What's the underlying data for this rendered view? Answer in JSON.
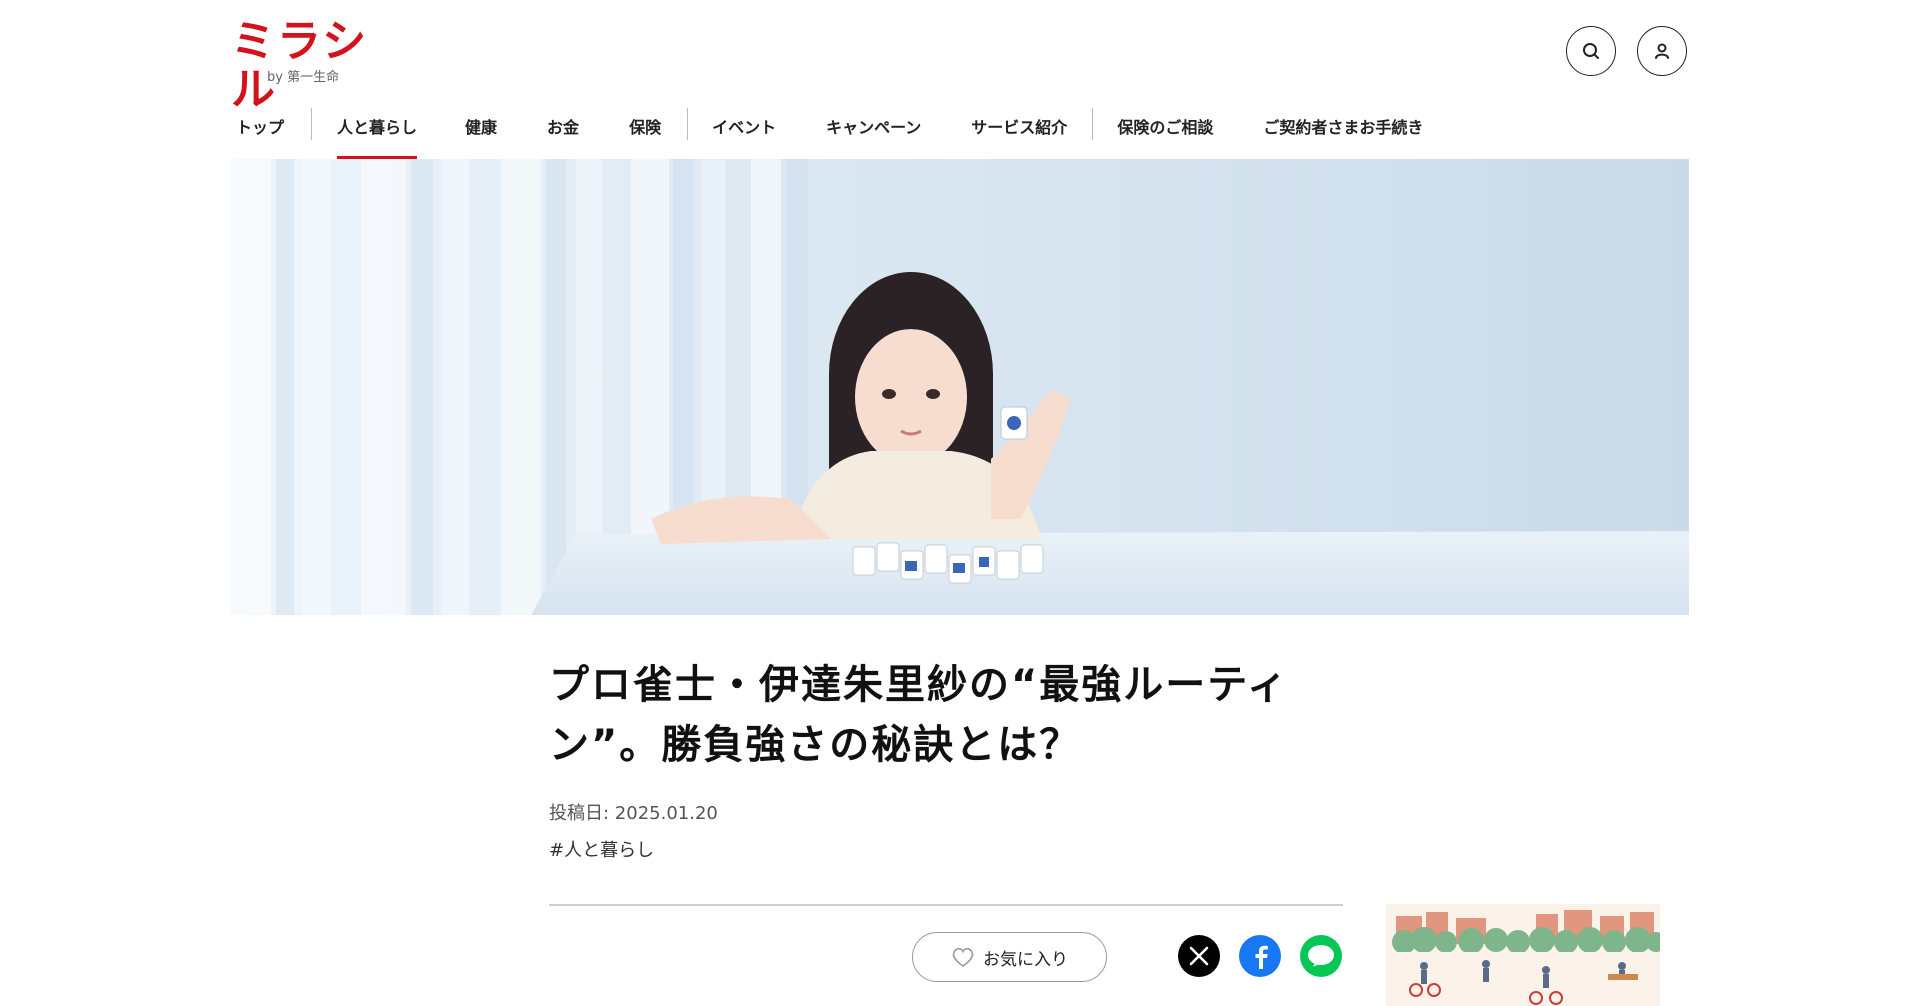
{
  "header": {
    "logo_text": "ミラシル",
    "logo_sub": "by 第一生命",
    "search_icon": "search-icon",
    "user_icon": "user-icon"
  },
  "nav": {
    "items": [
      {
        "label": "トップ"
      },
      {
        "label": "人と暮らし",
        "active": true
      },
      {
        "label": "健康"
      },
      {
        "label": "お金"
      },
      {
        "label": "保険"
      },
      {
        "label": "イベント"
      },
      {
        "label": "キャンペーン"
      },
      {
        "label": "サービス紹介"
      },
      {
        "label": "保険のご相談"
      },
      {
        "label": "ご契約者さまお手続き"
      }
    ],
    "accent_color": "#d3121b"
  },
  "article": {
    "title_line1": "プロ雀士・伊達朱里紗の“最強ルーティ",
    "title_line2": "ン”。勝負強さの秘訣とは？",
    "date": "投稿日: 2025.01.20",
    "tag": "#人と暮らし"
  },
  "actions": {
    "favorite_label": "お気に入り",
    "share": [
      "x-icon",
      "facebook-icon",
      "line-icon"
    ],
    "line_text": "LINE"
  }
}
